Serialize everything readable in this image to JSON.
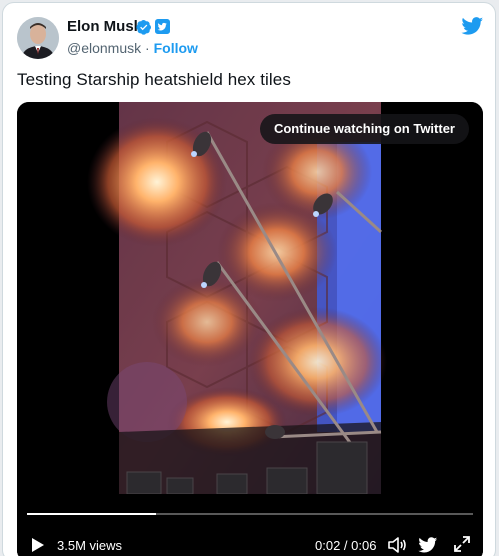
{
  "tweet": {
    "author_name": "Elon Musk",
    "handle": "@elonmusk",
    "separator": "·",
    "follow_label": "Follow",
    "text": "Testing Starship heatshield hex tiles"
  },
  "video": {
    "continue_label": "Continue watching on Twitter",
    "views": "3.5M views",
    "time": "0:02 / 0:06",
    "progress_fraction": 0.29
  },
  "colors": {
    "accent": "#1d9bf0",
    "verified": "#1d9bf0",
    "text": "#0f1419",
    "muted": "#536471"
  },
  "icons": [
    "avatar",
    "verified-badge-icon",
    "twitter-blue-badge-icon",
    "twitter-bird-icon",
    "play-icon",
    "volume-icon",
    "twitter-bird-icon",
    "expand-icon"
  ]
}
